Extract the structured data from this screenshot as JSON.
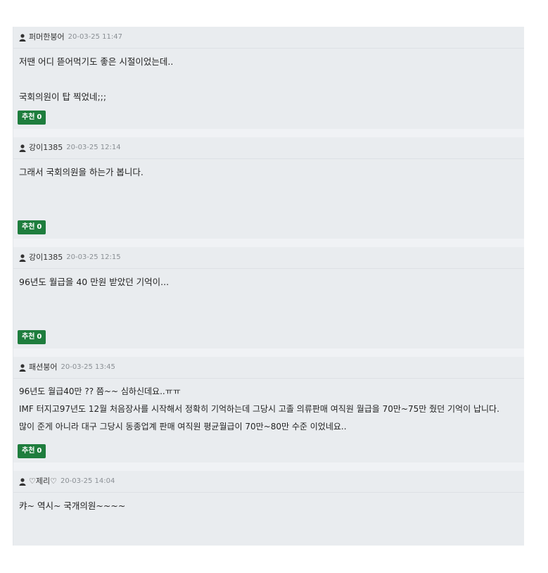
{
  "comments": [
    {
      "author": "퍼머한붕어",
      "time": "20-03-25 11:47",
      "body": "저땐 어디 뜯어먹기도 좋은 시절이었는데..\n\n국회의원이 탑 찍었네;;;",
      "like_label": "추천",
      "like_count": "0"
    },
    {
      "author": "강이1385",
      "time": "20-03-25 12:14",
      "body": "그래서 국회의원을 하는가 봅니다.",
      "like_label": "추천",
      "like_count": "0"
    },
    {
      "author": "강이1385",
      "time": "20-03-25 12:15",
      "body": "96년도 월급을 40 만원 받았던 기억이...",
      "like_label": "추천",
      "like_count": "0"
    },
    {
      "author": "패션붕어",
      "time": "20-03-25 13:45",
      "body": "96년도 월급40만 ?? 쯤~~ 심하신데요..ㅠㅠ\nIMF 터지고97년도 12월 처음장사를 시작해서 정확히 기억하는데 그당시 고졸 의류판매 여직원 월급을 70만~75만 줬던 기억이 납니다.\n많이 준게 아니라 대구 그당시 동종업계 판매 여직원 평균월급이 70만~80만 수준 이었네요..",
      "like_label": "추천",
      "like_count": "0"
    },
    {
      "author": "♡제리♡",
      "time": "20-03-25 14:04",
      "body": "캬~ 역시~ 국개의원~~~~"
    }
  ],
  "icons": {
    "author": "user-icon"
  },
  "colors": {
    "like_button": "#1e7d3d",
    "comment_bg": "#e9ecef"
  }
}
